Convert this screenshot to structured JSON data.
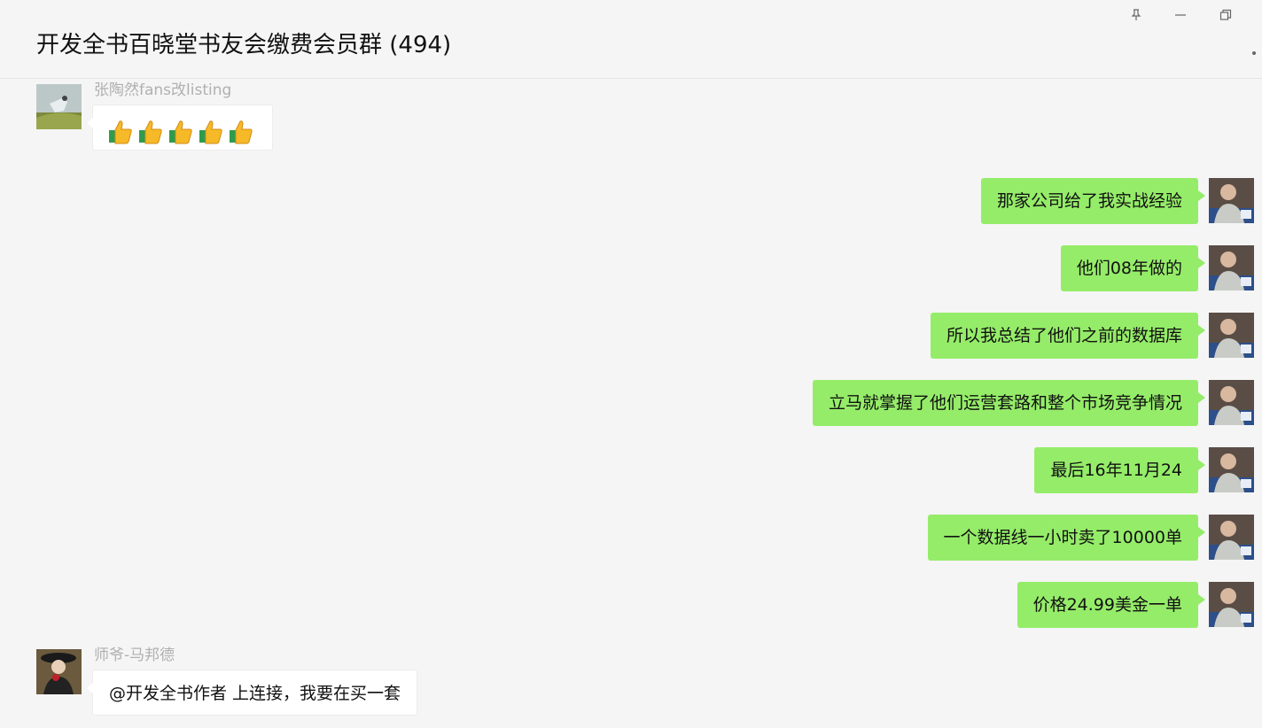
{
  "header": {
    "title": "开发全书百晓堂书友会缴费会员群 (494)"
  },
  "window_controls": [
    "pin-icon",
    "minimize-icon",
    "restore-icon"
  ],
  "messages": [
    {
      "side": "left",
      "sender": "张陶然fans改listing",
      "text": "",
      "content_type": "emoji",
      "emoji": "thumbs-up",
      "emoji_count": 5
    },
    {
      "side": "right",
      "text": "那家公司给了我实战经验"
    },
    {
      "side": "right",
      "text": "他们08年做的"
    },
    {
      "side": "right",
      "text": "所以我总结了他们之前的数据库"
    },
    {
      "side": "right",
      "text": "立马就掌握了他们运营套路和整个市场竞争情况"
    },
    {
      "side": "right",
      "text": "最后16年11月24"
    },
    {
      "side": "right",
      "text": "一个数据线一小时卖了10000单"
    },
    {
      "side": "right",
      "text": "价格24.99美金一单"
    },
    {
      "side": "left",
      "sender": "师爷-马邦德",
      "text": "@开发全书作者 上连接，我要在买一套"
    }
  ],
  "colors": {
    "background": "#f5f5f5",
    "self_bubble": "#95ec69",
    "other_bubble": "#ffffff",
    "sender_name": "#b0b0b0"
  }
}
